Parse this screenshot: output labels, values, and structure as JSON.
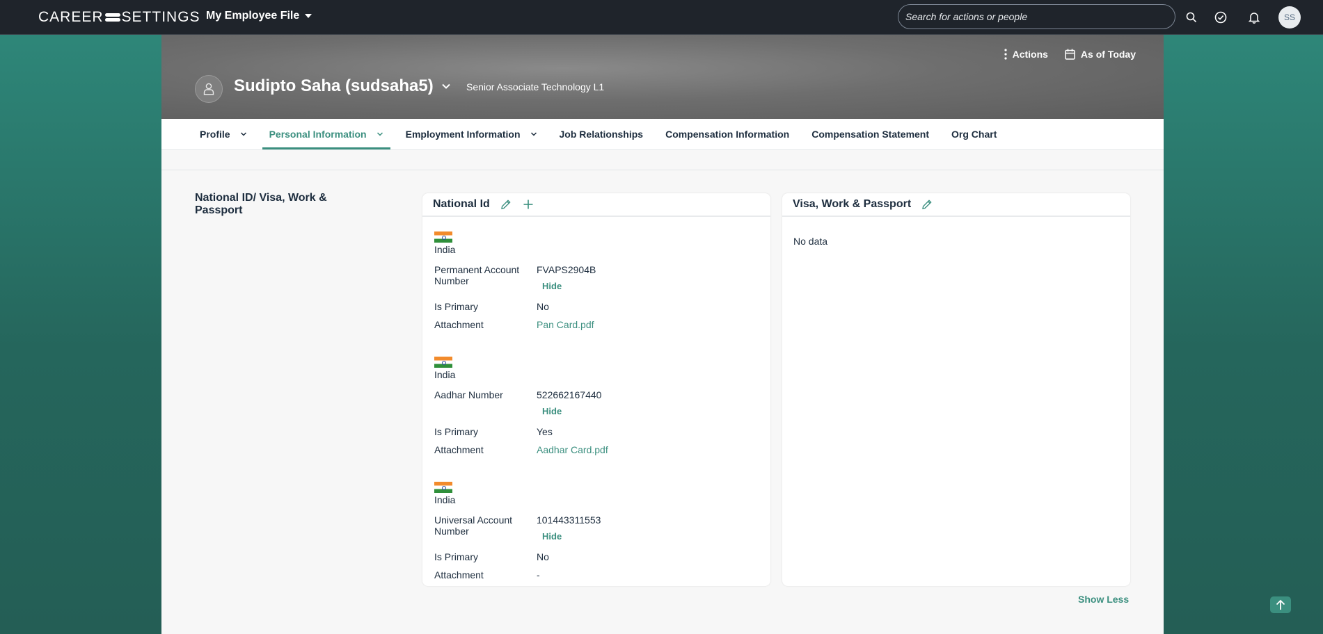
{
  "shell": {
    "logo_left": "CAREER",
    "logo_right": "SETTINGS",
    "app_menu_label": "My Employee File",
    "search_placeholder": "Search for actions or people",
    "avatar_initials": "SS"
  },
  "header": {
    "actions_label": "Actions",
    "as_of_label": "As of Today",
    "person_name": "Sudipto Saha (sudsaha5)",
    "person_title": "Senior Associate Technology L1"
  },
  "tabs": [
    {
      "label": "Profile"
    },
    {
      "label": "Personal Information"
    },
    {
      "label": "Employment Information"
    },
    {
      "label": "Job Relationships"
    },
    {
      "label": "Compensation Information"
    },
    {
      "label": "Compensation Statement"
    },
    {
      "label": "Org Chart"
    }
  ],
  "section": {
    "title": "National ID/ Visa, Work & Passport"
  },
  "national_id": {
    "title": "National Id",
    "labels": {
      "is_primary": "Is Primary",
      "attachment": "Attachment",
      "hide": "Hide"
    },
    "entries": [
      {
        "country": "India",
        "id_type": "Permanent Account Number",
        "id_value": "FVAPS2904B",
        "is_primary": "No",
        "attachment": "Pan Card.pdf"
      },
      {
        "country": "India",
        "id_type": "Aadhar Number",
        "id_value": "522662167440",
        "is_primary": "Yes",
        "attachment": "Aadhar Card.pdf"
      },
      {
        "country": "India",
        "id_type": "Universal Account Number",
        "id_value": "101443311553",
        "is_primary": "No",
        "attachment": "-"
      }
    ]
  },
  "visa": {
    "title": "Visa, Work & Passport",
    "empty_text": "No data"
  },
  "footer": {
    "show_less_label": "Show Less"
  },
  "colors": {
    "accent": "#3b8f7f",
    "shell": "#1f242b"
  }
}
